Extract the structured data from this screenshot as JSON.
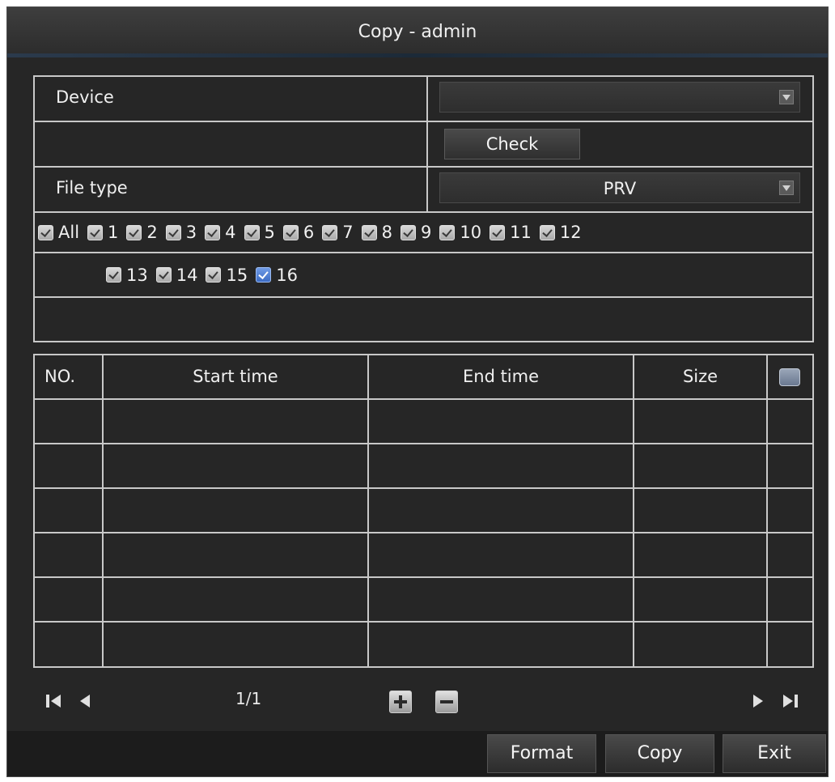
{
  "window": {
    "title": "Copy - admin"
  },
  "device": {
    "label": "Device",
    "value": ""
  },
  "check_button": "Check",
  "file_type": {
    "label": "File type",
    "value": "PRV"
  },
  "channels": {
    "all_label": "All",
    "row1": [
      "1",
      "2",
      "3",
      "4",
      "5",
      "6",
      "7",
      "8",
      "9",
      "10",
      "11",
      "12"
    ],
    "row2": [
      "13",
      "14",
      "15",
      "16"
    ],
    "highlighted": "16"
  },
  "table": {
    "headers": {
      "no": "NO.",
      "start": "Start time",
      "end": "End time",
      "size": "Size"
    },
    "rows": []
  },
  "pager": {
    "page": "1/1"
  },
  "footer": {
    "format": "Format",
    "copy": "Copy",
    "exit": "Exit"
  },
  "colors": {
    "background": "#262626",
    "grid": "#c8c8c8",
    "accent": "#1c2a38",
    "checkbox_selected": "#3c6cc4"
  }
}
